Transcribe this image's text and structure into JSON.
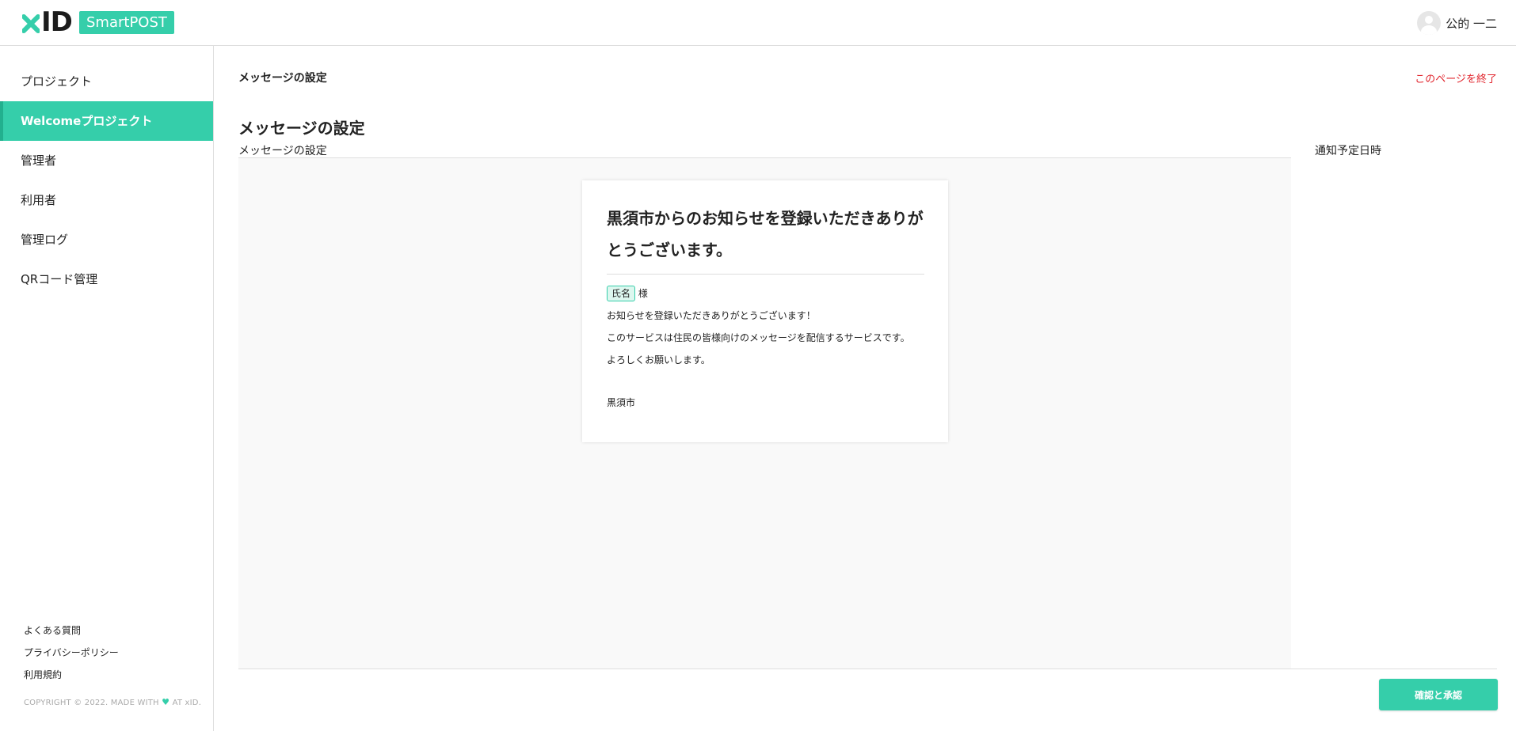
{
  "header": {
    "logo_text": "ID",
    "product": "SmartPOST",
    "user_name": "公的 一二"
  },
  "sidebar": {
    "items": [
      {
        "label": "プロジェクト",
        "active": false
      },
      {
        "label": "Welcomeプロジェクト",
        "active": true
      },
      {
        "label": "管理者",
        "active": false
      },
      {
        "label": "利用者",
        "active": false
      },
      {
        "label": "管理ログ",
        "active": false
      },
      {
        "label": "QRコード管理",
        "active": false
      }
    ],
    "footer_links": [
      "よくある質問",
      "プライバシーポリシー",
      "利用規約"
    ],
    "copyright_prefix": "COPYRIGHT © 2022. MADE WITH",
    "copyright_suffix": "AT xID."
  },
  "main": {
    "breadcrumb": "メッセージの設定",
    "exit_link": "このページを終了",
    "page_title": "メッセージの設定",
    "section_label": "メッセージの設定",
    "schedule_label": "通知予定日時",
    "message": {
      "title": "黒須市からのお知らせを登録いただきありがとうございます。",
      "name_tag": "氏名",
      "honorific": "様",
      "lines": [
        "お知らせを登録いただきありがとうございます！",
        "このサービスは住民の皆様向けのメッセージを配信するサービスです。",
        "よろしくお願いします。"
      ],
      "signature": "黒須市"
    },
    "confirm_button": "確認と承認"
  },
  "colors": {
    "accent": "#35ceaa",
    "danger": "#e1242c"
  }
}
